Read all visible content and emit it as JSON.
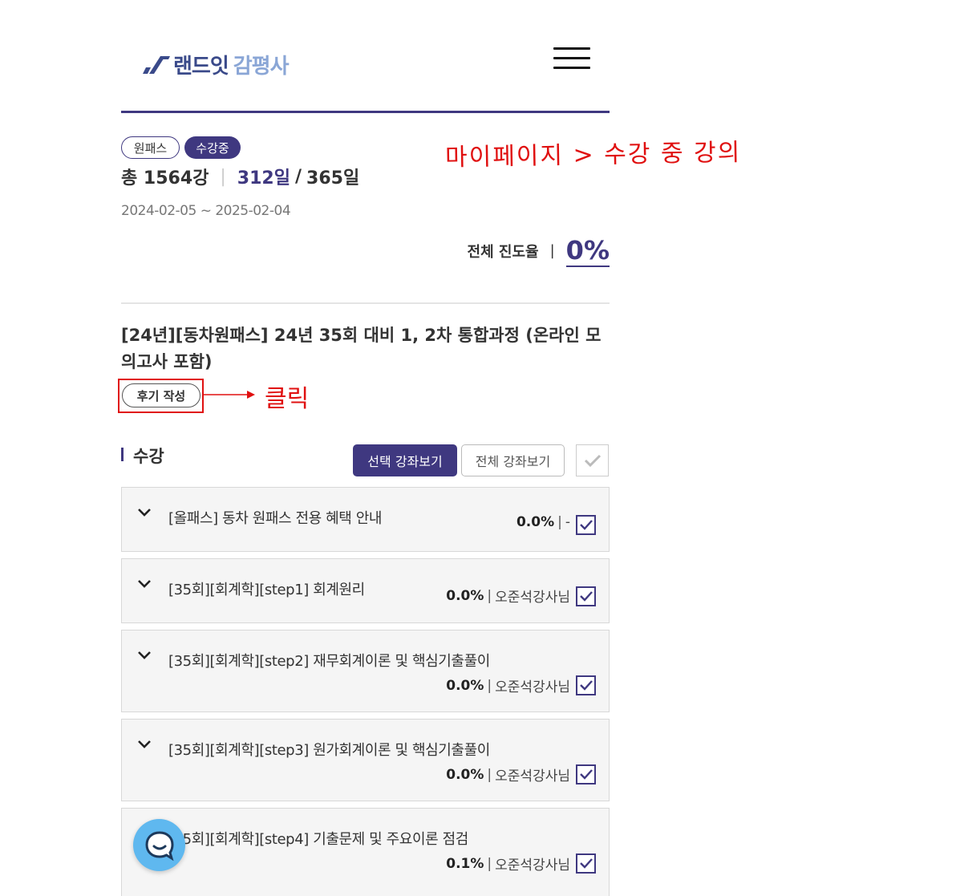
{
  "header": {
    "logo_main": "랜드잇",
    "logo_sub": "감평사"
  },
  "badges": {
    "type": "원패스",
    "status": "수강중"
  },
  "summary": {
    "total": "총 1564강",
    "days_used": "312일",
    "slash": "/",
    "days_total": "365일"
  },
  "period": "2024-02-05 ~ 2025-02-04",
  "progress": {
    "label": "전체 진도율",
    "sep": "|",
    "value": "0%"
  },
  "course": {
    "title": "[24년][동차원패스] 24년 35회 대비 1, 2차 통합과정 (온라인 모의고사 포함)",
    "review_button": "후기 작성"
  },
  "annotations": {
    "top": "마이페이지 > 수강 중 강의",
    "click": "클릭"
  },
  "section": {
    "title": "수강",
    "btn_select": "선택 강좌보기",
    "btn_all": "전체 강좌보기"
  },
  "lectures": [
    {
      "title": "[올패스] 동차 원패스 전용 혜택 안내",
      "progress": "0.0%",
      "sep": "|",
      "teacher": "-"
    },
    {
      "title": "[35회][회계학][step1] 회계원리",
      "progress": "0.0%",
      "sep": "|",
      "teacher": "오준석강사님"
    },
    {
      "title": "[35회][회계학][step2] 재무회계이론 및 핵심기출풀이",
      "progress": "0.0%",
      "sep": "|",
      "teacher": "오준석강사님"
    },
    {
      "title": "[35회][회계학][step3] 원가회계이론 및 핵심기출풀이",
      "progress": "0.0%",
      "sep": "|",
      "teacher": "오준석강사님"
    },
    {
      "title": "[35회][회계학][step4] 기출문제 및 주요이론 점검",
      "progress": "0.1%",
      "sep": "|",
      "teacher": "오준석강사님"
    }
  ],
  "colors": {
    "brand": "#3f3880",
    "annotation": "#e01010",
    "chat": "#5fb8ef"
  }
}
